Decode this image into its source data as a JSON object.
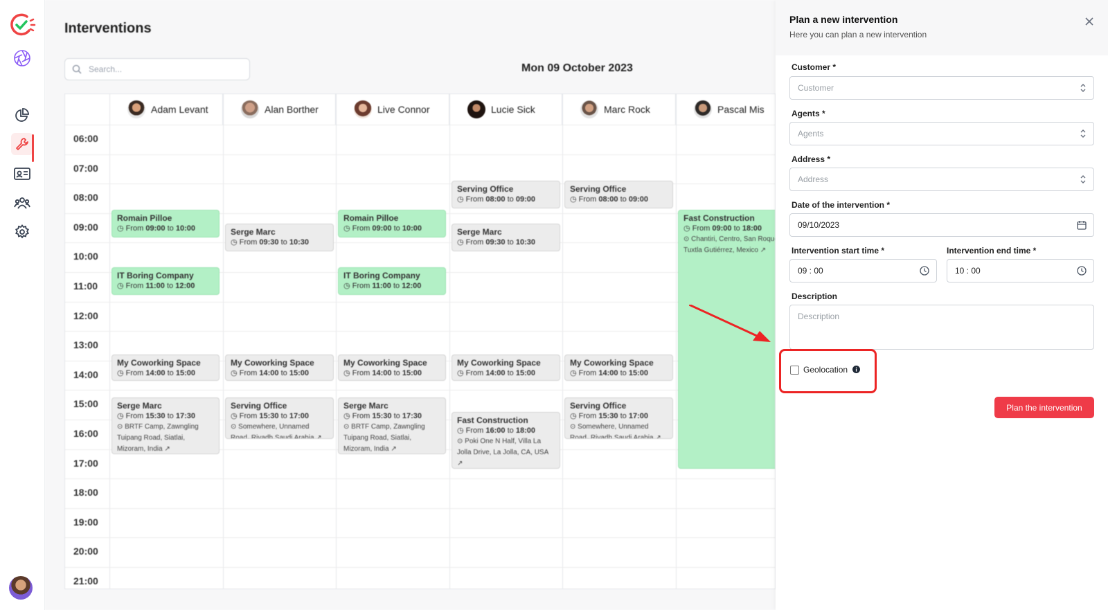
{
  "page": {
    "title": "Interventions"
  },
  "search": {
    "placeholder": "Search..."
  },
  "calendar": {
    "date_label": "Mon 09 October 2023",
    "agents": [
      "Adam Levant",
      "Alan Borther",
      "Live Connor",
      "Lucie Sick",
      "Marc Rock",
      "Pascal Mis"
    ],
    "hours": [
      "06:00",
      "07:00",
      "08:00",
      "09:00",
      "10:00",
      "11:00",
      "12:00",
      "13:00",
      "14:00",
      "15:00",
      "16:00",
      "17:00",
      "18:00",
      "19:00",
      "20:00",
      "21:00"
    ],
    "events": [
      {
        "title": "Romain Pilloe",
        "from": "09:00",
        "to": "10:00"
      },
      {
        "title": "IT Boring Company",
        "from": "11:00",
        "to": "12:00"
      },
      {
        "title": "My Coworking Space",
        "from": "14:00",
        "to": "15:00"
      },
      {
        "title": "Serge Marc",
        "from": "15:30",
        "to": "17:30",
        "address": "BRTF Camp, Zawngling Tuipang Road, Siatlai, Mizoram, India"
      },
      {
        "title": "Serge Marc",
        "from": "09:30",
        "to": "10:30"
      },
      {
        "title": "My Coworking Space",
        "from": "14:00",
        "to": "15:00"
      },
      {
        "title": "Serving Office",
        "from": "15:30",
        "to": "17:00",
        "address": "Somewhere, Unnamed Road، Riyadh Saudi Arabia"
      },
      {
        "title": "Romain Pilloe",
        "from": "09:00",
        "to": "10:00"
      },
      {
        "title": "IT Boring Company",
        "from": "11:00",
        "to": "12:00"
      },
      {
        "title": "My Coworking Space",
        "from": "14:00",
        "to": "15:00"
      },
      {
        "title": "Serge Marc",
        "from": "15:30",
        "to": "17:30",
        "address": "BRTF Camp, Zawngling Tuipang Road, Siatlai, Mizoram, India"
      },
      {
        "title": "Serving Office",
        "from": "08:00",
        "to": "09:00"
      },
      {
        "title": "Serge Marc",
        "from": "09:30",
        "to": "10:30"
      },
      {
        "title": "My Coworking Space",
        "from": "14:00",
        "to": "15:00"
      },
      {
        "title": "Fast Construction",
        "from": "16:00",
        "to": "18:00",
        "address": "Poki One N Half, Villa La Jolla Drive, La Jolla, CA, USA"
      },
      {
        "title": "Serving Office",
        "from": "08:00",
        "to": "09:00"
      },
      {
        "title": "My Coworking Space",
        "from": "14:00",
        "to": "15:00"
      },
      {
        "title": "Serving Office",
        "from": "15:30",
        "to": "17:00",
        "address": "Somewhere, Unnamed Road، Riyadh Saudi Arabia"
      },
      {
        "title": "Fast Construction",
        "from": "09:00",
        "to": "18:00",
        "address": "Chantiri, Centro, San Roque, Tuxtla Gutiérrez, Mexico"
      }
    ],
    "from_word": "From",
    "to_word": "to"
  },
  "panel": {
    "title": "Plan a new intervention",
    "subtitle": "Here you can plan a new intervention",
    "customer": {
      "label": "Customer *",
      "placeholder": "Customer"
    },
    "agents": {
      "label": "Agents *",
      "placeholder": "Agents"
    },
    "address": {
      "label": "Address *",
      "placeholder": "Address"
    },
    "date": {
      "label": "Date of the intervention *",
      "value": "09/10/2023"
    },
    "start_time": {
      "label": "Intervention start time *",
      "value": "09 : 00"
    },
    "end_time": {
      "label": "Intervention end time *",
      "value": "10 : 00"
    },
    "description": {
      "label": "Description",
      "placeholder": "Description"
    },
    "geolocation": {
      "label": "Geolocation",
      "checked": false
    },
    "submit_label": "Plan the intervention"
  },
  "colors": {
    "accent": "#ef3b48",
    "event_green": "#b3f0c6",
    "event_gray": "#ececec",
    "highlight_red": "#ec2424"
  }
}
